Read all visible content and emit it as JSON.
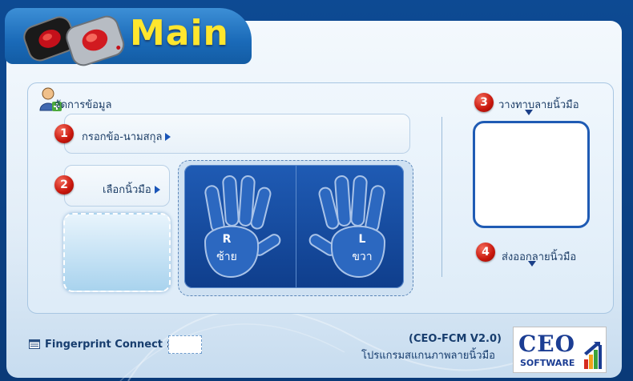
{
  "header": {
    "title": "Main"
  },
  "form": {
    "section_title": "จัดการข้อมูล",
    "step1": {
      "number": "1",
      "label": "กรอกข้อ-นามสกุล"
    },
    "step2": {
      "number": "2",
      "label": "เลือกนิ้วมือ"
    },
    "step3": {
      "number": "3",
      "label": "วางทาบลายนิ้วมือ"
    },
    "step4": {
      "number": "4",
      "label": "ส่งออกลายนิ้วมือ"
    }
  },
  "hands": {
    "right": {
      "letter": "R",
      "word": "ซ้าย"
    },
    "left": {
      "letter": "L",
      "word": "ขวา"
    }
  },
  "footer": {
    "connect_label": "Fingerprint Connect :",
    "version": "(CEO-FCM V2.0)",
    "program_name": "โปรแกรมสแกนภาพลายนิ้วมือ"
  },
  "logo": {
    "main": "CEO",
    "sub": "SOFTWARE"
  },
  "colors": {
    "accent_blue": "#1f5bb4",
    "title_yellow": "#ffe62e",
    "step_red": "#c8160c"
  },
  "icons": [
    "fingerprint-scanner-icon",
    "add-user-icon",
    "connect-icon",
    "logo-bars-icon"
  ]
}
